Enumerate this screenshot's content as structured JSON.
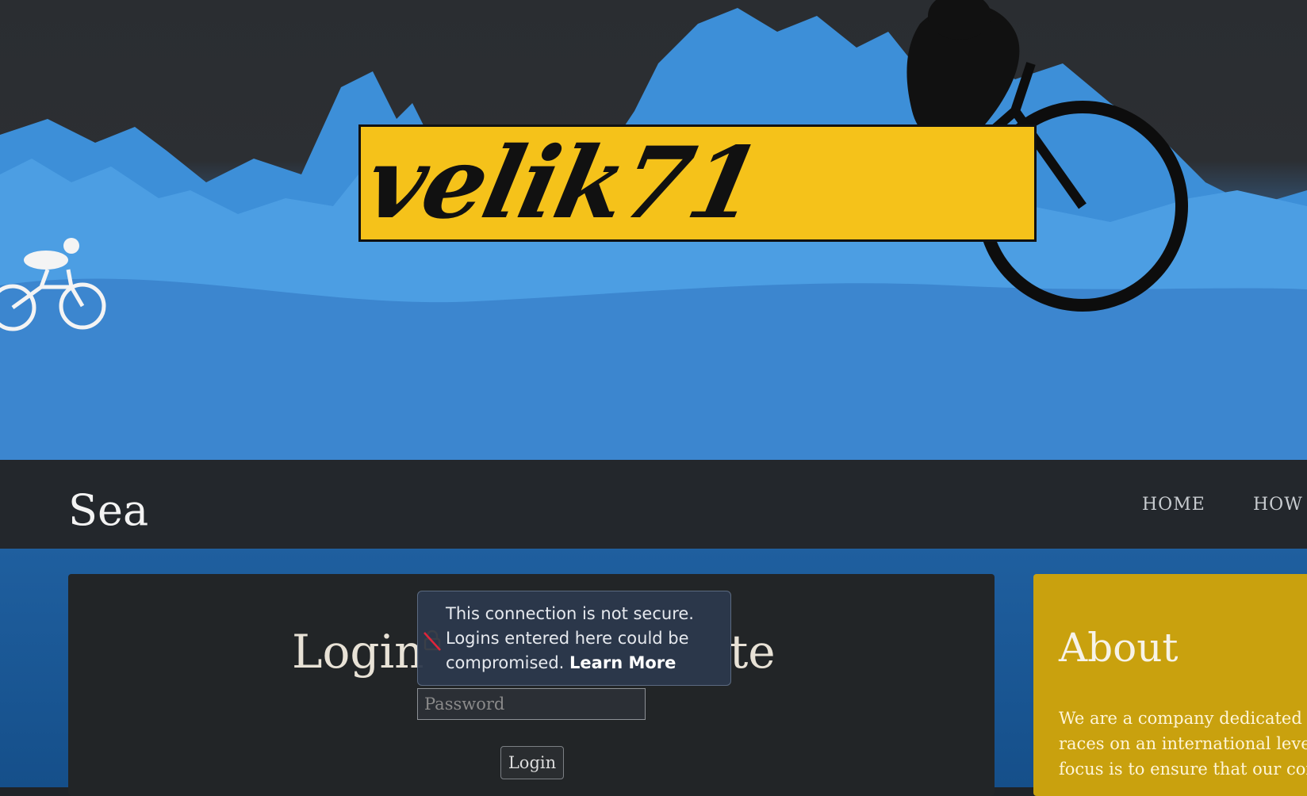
{
  "banner": {
    "logo_text": "velik71"
  },
  "navbar": {
    "site_title": "Sea",
    "links": [
      {
        "label": "HOME"
      },
      {
        "label": "HOW"
      }
    ]
  },
  "login": {
    "heading_left": "Login",
    "heading_right": "te",
    "password_placeholder": "Password",
    "button_label": "Login"
  },
  "security_warning": {
    "line1": "This connection is not secure.",
    "line2": "Logins entered here could be",
    "line3": "compromised.",
    "link_label": "Learn More",
    "icon": "insecure-lock-icon"
  },
  "about": {
    "heading": "About",
    "lines": [
      "We are a company dedicated",
      "races on an international leve",
      "focus is to ensure that our cor"
    ]
  },
  "colors": {
    "accent_yellow": "#f5c21a",
    "banner_blue": "#3a7fc6",
    "nav_bg": "#23272c",
    "about_bg": "#c9a10e"
  }
}
